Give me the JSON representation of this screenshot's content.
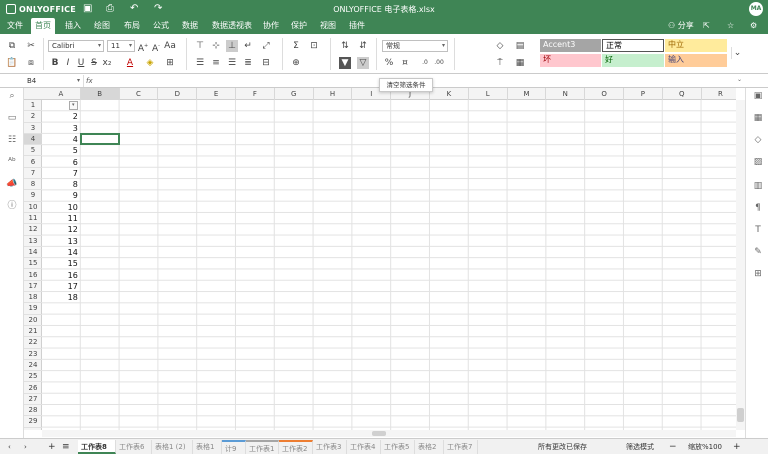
{
  "app": {
    "logo": "ONLYOFFICE",
    "title": "ONLYOFFICE 电子表格.xlsx",
    "avatar": "MA",
    "share": "分享"
  },
  "menu": [
    "文件",
    "首页",
    "插入",
    "绘图",
    "布局",
    "公式",
    "数据",
    "数据透视表",
    "协作",
    "保护",
    "视图",
    "插件"
  ],
  "ribbon": {
    "font": "Calibri",
    "size": "11",
    "number_format": "常规"
  },
  "styles": [
    {
      "label": "Accent3",
      "bg": "#a5a5a5",
      "color": "#ffffff"
    },
    {
      "label": "正常",
      "bg": "#ffffff",
      "color": "#000000"
    },
    {
      "label": "中立",
      "bg": "#ffeb9c",
      "color": "#9c6500"
    },
    {
      "label": "坏",
      "bg": "#ffc7ce",
      "color": "#9c0006"
    },
    {
      "label": "好",
      "bg": "#c6efce",
      "color": "#006100"
    },
    {
      "label": "输入",
      "bg": "#ffcc99",
      "color": "#3f3f76"
    }
  ],
  "formula_bar": {
    "cell_ref": "B4",
    "fx": "fx"
  },
  "tooltip": "清空筛选条件",
  "columns": [
    "A",
    "B",
    "C",
    "D",
    "E",
    "F",
    "G",
    "H",
    "I",
    "J",
    "K",
    "L",
    "M",
    "N",
    "O",
    "P",
    "Q",
    "R"
  ],
  "rows": [
    "1",
    "2",
    "3",
    "4",
    "5",
    "6",
    "7",
    "8",
    "9",
    "10",
    "11",
    "12",
    "13",
    "14",
    "15",
    "16",
    "17",
    "18",
    "19",
    "20",
    "21",
    "22",
    "23",
    "24",
    "25",
    "26",
    "27",
    "28",
    "29"
  ],
  "cells_A": [
    "",
    "2",
    "3",
    "4",
    "5",
    "6",
    "7",
    "8",
    "9",
    "10",
    "11",
    "12",
    "13",
    "14",
    "15",
    "16",
    "17",
    "18"
  ],
  "sheets": [
    "工作表8",
    "工作表6",
    "表格1 (2)",
    "表格1",
    "计9",
    "工作表1",
    "工作表2",
    "工作表3",
    "工作表4",
    "工作表5",
    "表格2",
    "工作表7"
  ],
  "sheet_colors": {
    "4": "#5b9bd5",
    "5": "#a5a5a5",
    "6": "#ed7d31"
  },
  "status": {
    "saved": "所有更改已保存",
    "filter_mode": "筛选模式",
    "zoom": "缩放%100"
  }
}
